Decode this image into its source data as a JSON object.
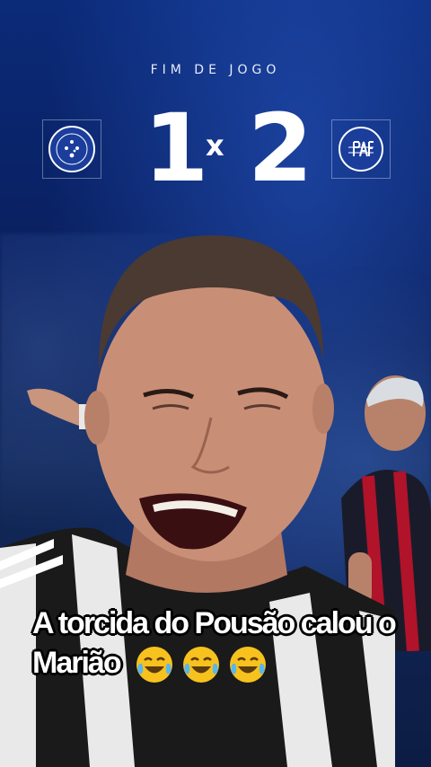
{
  "scoreboard": {
    "title": "FIM DE JOGO",
    "home_score": "1",
    "separator": "x",
    "away_score": "2",
    "home_badge_icon": "cruzeiro-crest-icon",
    "away_badge_icon": "paf-crest-icon"
  },
  "caption": {
    "line1": "A torcida do Pousão calou o",
    "line2": "Marião",
    "emojis": [
      "face-with-tears-of-joy-icon",
      "face-with-tears-of-joy-icon",
      "face-with-tears-of-joy-icon"
    ]
  },
  "colors": {
    "background": "#0b2a78",
    "caption_text": "#ffffff",
    "caption_outline": "#000000"
  }
}
